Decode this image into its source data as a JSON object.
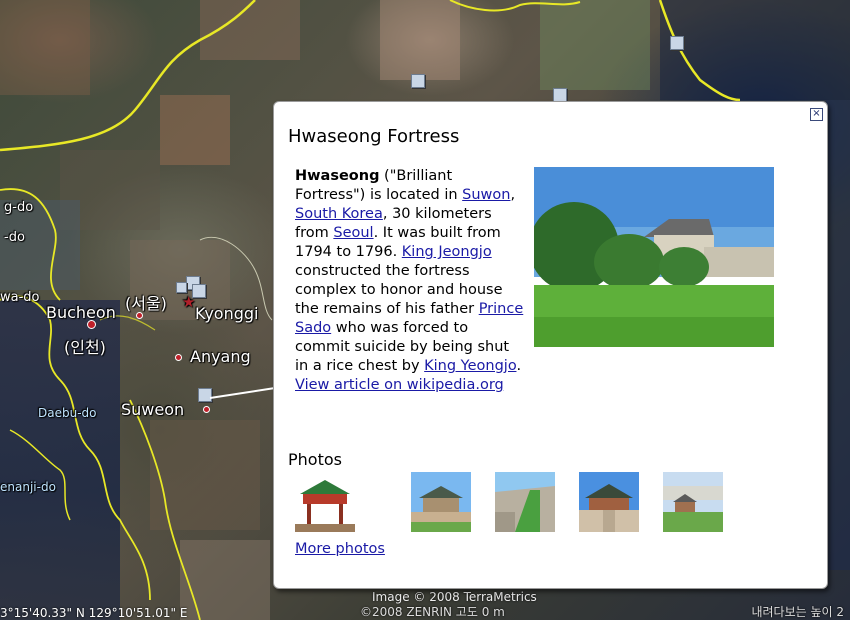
{
  "map": {
    "labels": {
      "gido": "g-do",
      "tido": "-do",
      "wado": "wa-do",
      "bucheon": "Bucheon",
      "incheon_kr": "(인천)",
      "seoul_kr": "(서울)",
      "kyonggi": "Kyonggi",
      "anyang": "Anyang",
      "suweon": "Suweon",
      "daebudo": "Daebu-do",
      "yeonanjido": "enanji-do"
    },
    "coords": "3°15'40.33\" N    129°10'51.01\" E",
    "attribution": "Image © 2008 TerraMetrics",
    "attribution2": "©2008 ZENRIN   고도   0 m",
    "bottom_right": "내려다보는 높이  2"
  },
  "balloon": {
    "title": "Hwaseong Fortress",
    "close_label": "×",
    "body": {
      "bold": "Hwaseong",
      "t1": " (\"Brilliant Fortress\") is located in ",
      "link_suwon": "Suwon",
      "t2": ", ",
      "link_korea": "South Korea",
      "t3": ", 30 kilometers from ",
      "link_seoul": "Seoul",
      "t4": ". It was built from 1794 to 1796. ",
      "link_jeongjo": "King Jeongjo",
      "t5": " constructed the fortress complex to honor and house the remains of his father ",
      "link_sado": "Prince Sado",
      "t6": " who was forced to commit suicide by being shut in a rice chest by ",
      "link_yeongjo": "King Yeongjo",
      "t7": ".",
      "link_wiki": "View article on wikipedia.org"
    },
    "photos_heading": "Photos",
    "more_photos": "More photos"
  },
  "colors": {
    "link": "#1a1aa6",
    "border_yellow": "#e8e826",
    "marker_red": "#c0202a"
  }
}
